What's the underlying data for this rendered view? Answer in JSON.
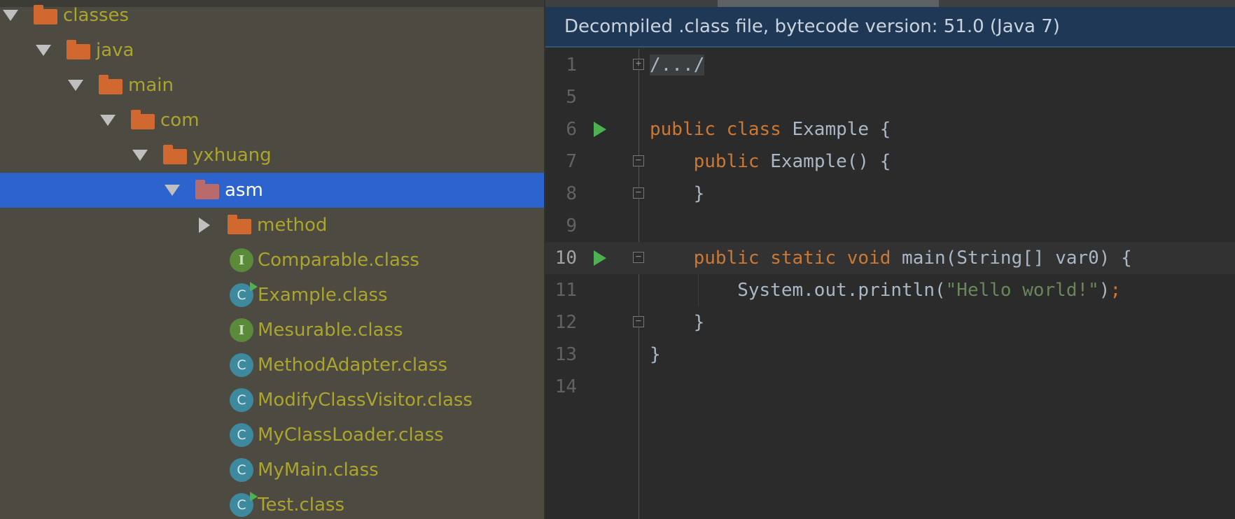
{
  "project_tree": {
    "items": [
      {
        "label": "classes",
        "kind": "folder",
        "expanded": true
      },
      {
        "label": "java",
        "kind": "folder",
        "expanded": true
      },
      {
        "label": "main",
        "kind": "folder",
        "expanded": true
      },
      {
        "label": "com",
        "kind": "folder",
        "expanded": true
      },
      {
        "label": "yxhuang",
        "kind": "folder",
        "expanded": true
      },
      {
        "label": "asm",
        "kind": "package",
        "expanded": true,
        "selected": true
      },
      {
        "label": "method",
        "kind": "folder",
        "expanded": false
      },
      {
        "label": "Comparable.class",
        "kind": "interface",
        "badge": "I"
      },
      {
        "label": "Example.class",
        "kind": "class",
        "badge": "C",
        "runnable": true
      },
      {
        "label": "Mesurable.class",
        "kind": "interface",
        "badge": "I"
      },
      {
        "label": "MethodAdapter.class",
        "kind": "class",
        "badge": "C"
      },
      {
        "label": "ModifyClassVisitor.class",
        "kind": "class",
        "badge": "C"
      },
      {
        "label": "MyClassLoader.class",
        "kind": "class",
        "badge": "C"
      },
      {
        "label": "MyMain.class",
        "kind": "class",
        "badge": "C"
      },
      {
        "label": "Test.class",
        "kind": "class",
        "badge": "C",
        "runnable": true
      }
    ]
  },
  "editor": {
    "banner": "Decompiled .class file, bytecode version: 51.0 (Java 7)",
    "current_line": "10",
    "lines": [
      {
        "num": "1",
        "tokens": [
          {
            "t": "/.../",
            "c": "fold-dots"
          }
        ]
      },
      {
        "num": "5",
        "tokens": []
      },
      {
        "num": "6",
        "tokens": [
          {
            "t": "public class ",
            "c": "kw"
          },
          {
            "t": "Example {",
            "c": ""
          }
        ]
      },
      {
        "num": "7",
        "tokens": [
          {
            "t": "    "
          },
          {
            "t": "public ",
            "c": "kw"
          },
          {
            "t": "Example() {",
            "c": ""
          }
        ]
      },
      {
        "num": "8",
        "tokens": [
          {
            "t": "    }"
          }
        ]
      },
      {
        "num": "9",
        "tokens": []
      },
      {
        "num": "10",
        "tokens": [
          {
            "t": "    "
          },
          {
            "t": "public static void ",
            "c": "kw"
          },
          {
            "t": "main(String[] var0) {",
            "c": ""
          }
        ]
      },
      {
        "num": "11",
        "tokens": [
          {
            "t": "        System.out.println("
          },
          {
            "t": "\"Hello world!\"",
            "c": "str"
          },
          {
            "t": ")"
          },
          {
            "t": ";",
            "c": "kw"
          }
        ]
      },
      {
        "num": "12",
        "tokens": [
          {
            "t": "    }"
          }
        ]
      },
      {
        "num": "13",
        "tokens": [
          {
            "t": "}"
          }
        ]
      },
      {
        "num": "14",
        "tokens": []
      }
    ]
  },
  "colors": {
    "tree_bg": "#4d4a41",
    "selection": "#2d63cc",
    "file_text": "#aba42d",
    "keyword": "#cc7832",
    "string": "#6a8759",
    "banner_bg": "#1f3856"
  }
}
